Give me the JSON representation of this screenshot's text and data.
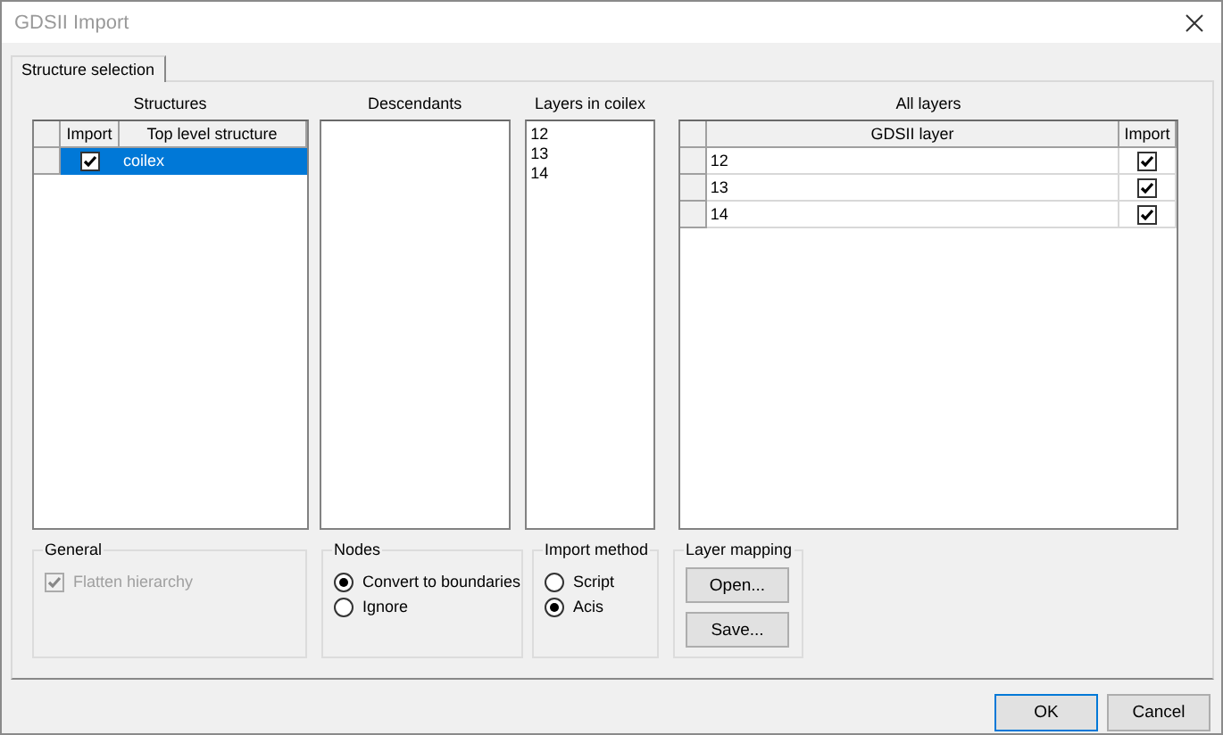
{
  "window": {
    "title": "GDSII Import"
  },
  "tabs": [
    {
      "label": "Structure selection",
      "selected": true
    }
  ],
  "structures": {
    "heading": "Structures",
    "columns": [
      "Import",
      "Top level structure"
    ],
    "rows": [
      {
        "name": "coilex",
        "import": true,
        "selected": true
      }
    ]
  },
  "descendants": {
    "heading": "Descendants"
  },
  "layers_in_structure": {
    "heading": "Layers in coilex",
    "items": [
      "12",
      "13",
      "14"
    ]
  },
  "all_layers": {
    "heading": "All layers",
    "columns": [
      "GDSII layer",
      "Import"
    ],
    "rows": [
      {
        "layer": "12",
        "import": true
      },
      {
        "layer": "13",
        "import": true
      },
      {
        "layer": "14",
        "import": true
      }
    ]
  },
  "general": {
    "label": "General",
    "options": [
      {
        "label": "Flatten hierarchy",
        "checked": true,
        "disabled": true
      }
    ]
  },
  "nodes": {
    "label": "Nodes",
    "options": [
      {
        "label": "Convert to boundaries",
        "selected": true
      },
      {
        "label": "Ignore",
        "selected": false
      }
    ]
  },
  "import_method": {
    "label": "Import method",
    "options": [
      {
        "label": "Script",
        "selected": false
      },
      {
        "label": "Acis",
        "selected": true
      }
    ]
  },
  "layer_mapping": {
    "label": "Layer mapping",
    "buttons": [
      "Open...",
      "Save..."
    ]
  },
  "buttons": [
    "OK",
    "Cancel"
  ]
}
